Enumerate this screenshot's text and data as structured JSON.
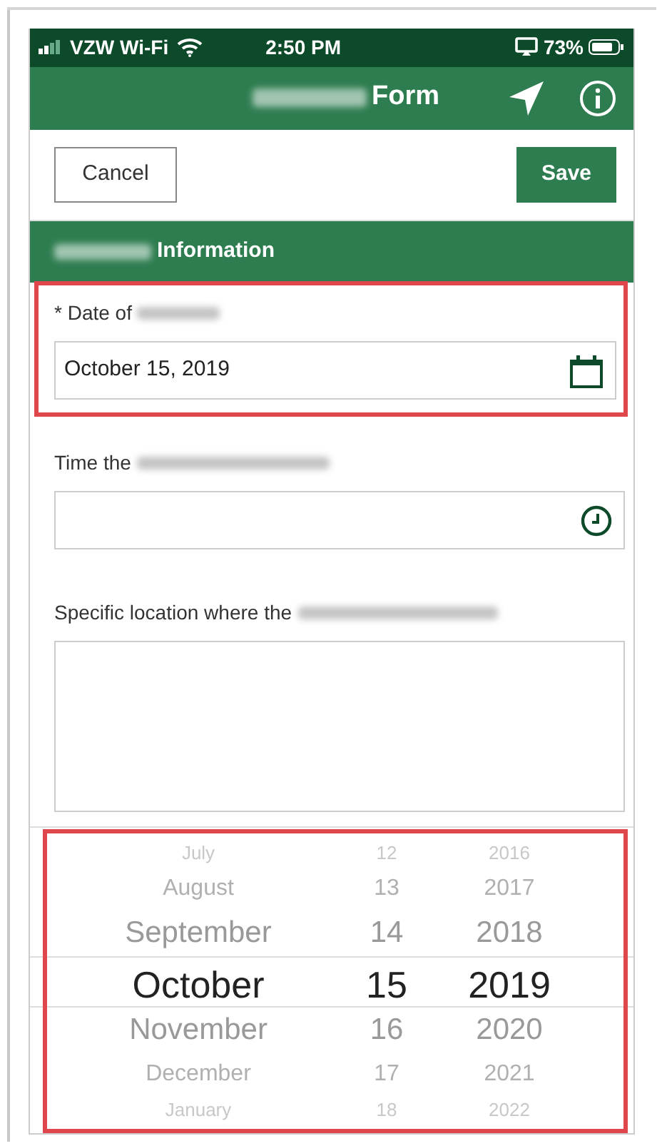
{
  "status_bar": {
    "carrier": "VZW Wi-Fi",
    "time": "2:50 PM",
    "battery": "73%"
  },
  "header": {
    "title": "Form",
    "title_blurred": true
  },
  "toolbar": {
    "cancel": "Cancel",
    "save": "Save"
  },
  "section": {
    "title": "Information",
    "title_blurred": true
  },
  "fields": [
    {
      "kind": "date",
      "label": "* Date of",
      "label_blurred": true,
      "value": "October 15, 2019",
      "highlighted": true
    },
    {
      "kind": "time",
      "label": "Time the",
      "label_blurred": true,
      "highlighted": false
    },
    {
      "kind": "textarea",
      "label": "Specific location where the",
      "label_blurred": true,
      "highlighted": false
    }
  ],
  "picker": {
    "highlighted": true,
    "rows": [
      {
        "month": "July",
        "day": "12",
        "year": "2016",
        "selected": false
      },
      {
        "month": "August",
        "day": "13",
        "year": "2017",
        "selected": false
      },
      {
        "month": "September",
        "day": "14",
        "year": "2018",
        "selected": false
      },
      {
        "month": "October",
        "day": "15",
        "year": "2019",
        "selected": true
      },
      {
        "month": "November",
        "day": "16",
        "year": "2020",
        "selected": false
      },
      {
        "month": "December",
        "day": "17",
        "year": "2021",
        "selected": false
      },
      {
        "month": "January",
        "day": "18",
        "year": "2022",
        "selected": false
      }
    ]
  }
}
